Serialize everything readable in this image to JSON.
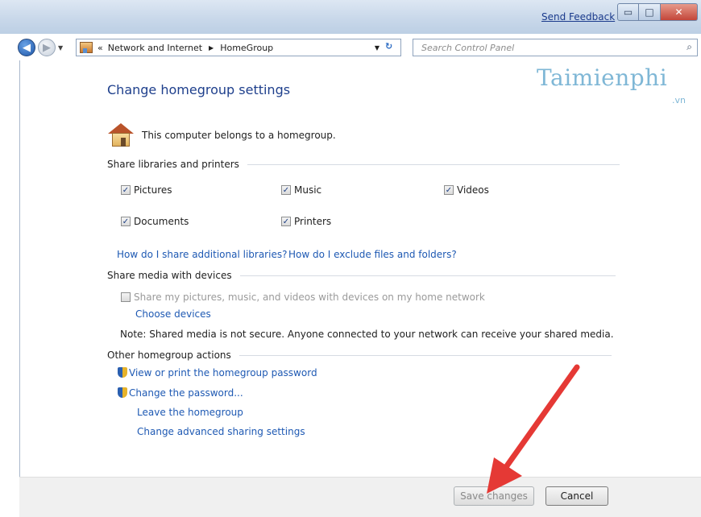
{
  "window": {
    "feedback_link": "Send Feedback",
    "minimize_glyph": "▭",
    "maximize_glyph": "□",
    "close_glyph": "✕"
  },
  "nav": {
    "back_glyph": "◀",
    "forward_glyph": "▶",
    "history_dropdown_glyph": "▼"
  },
  "address_bar": {
    "prefix": "«",
    "crumbs": [
      "Network and Internet",
      "HomeGroup"
    ],
    "separator": "▶",
    "dropdown_glyph": "▼",
    "refresh_glyph": "↻"
  },
  "search": {
    "placeholder": "Search Control Panel",
    "icon": "search-icon",
    "icon_glyph": "⌕"
  },
  "watermark": {
    "brand": "Taimienphi",
    "domain": ".vn"
  },
  "page": {
    "title": "Change homegroup settings",
    "belongs_text": "This computer belongs to a homegroup."
  },
  "share_libraries": {
    "heading": "Share libraries and printers",
    "check_glyph": "✓",
    "items": [
      {
        "label": "Pictures",
        "checked": true
      },
      {
        "label": "Music",
        "checked": true
      },
      {
        "label": "Videos",
        "checked": true
      },
      {
        "label": "Documents",
        "checked": true
      },
      {
        "label": "Printers",
        "checked": true
      }
    ],
    "link_additional": "How do I share additional libraries?",
    "link_exclude": "How do I exclude files and folders?"
  },
  "share_media": {
    "heading": "Share media with devices",
    "checkbox_label": "Share my pictures, music, and videos with devices on my home network",
    "checkbox_checked": false,
    "choose_devices": "Choose devices",
    "note": "Note: Shared media is not secure. Anyone connected to your network can receive your shared media."
  },
  "other_actions": {
    "heading": "Other homegroup actions",
    "view_password": "View or print the homegroup password",
    "change_password": "Change the password...",
    "leave": "Leave the homegroup",
    "advanced": "Change advanced sharing settings"
  },
  "footer": {
    "save": "Save changes",
    "cancel": "Cancel"
  },
  "colors": {
    "link": "#1e59b3",
    "title": "#1e3f8c",
    "annotation_arrow": "#e53935",
    "watermark": "#7fb7d6"
  }
}
